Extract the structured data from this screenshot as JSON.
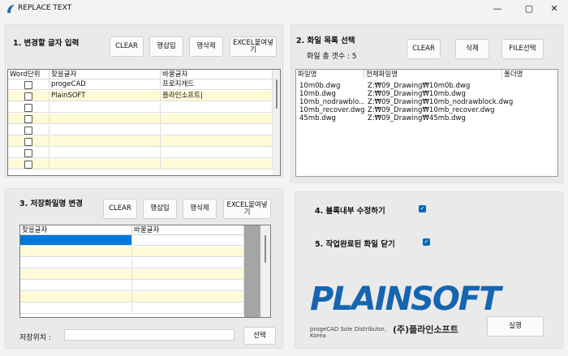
{
  "window": {
    "title": "REPLACE TEXT",
    "min": "—",
    "max": "▢",
    "close": "✕"
  },
  "text_section": {
    "title": "1. 변경할 글자 입력",
    "buttons": [
      "CLEAR",
      "행삽입",
      "행삭제",
      "EXCEL붙여넣기"
    ],
    "columns": [
      "Word단위",
      "찾을글자",
      "바꿀글자"
    ],
    "rows": [
      {
        "find": "progeCAD",
        "replace": "프로지캐드"
      },
      {
        "find": "PlainSOFT",
        "replace": "플라인소프트|"
      },
      {
        "find": "",
        "replace": ""
      },
      {
        "find": "",
        "replace": ""
      },
      {
        "find": "",
        "replace": ""
      },
      {
        "find": "",
        "replace": ""
      },
      {
        "find": "",
        "replace": ""
      },
      {
        "find": "",
        "replace": ""
      }
    ]
  },
  "file_section": {
    "title": "2. 화일 목록 선택",
    "count_label": "화일 총 갯수 : 5",
    "buttons": [
      "CLEAR",
      "삭제",
      "FILE선택"
    ],
    "columns": [
      "파일명",
      "전체파일명",
      "폴더명"
    ],
    "files": [
      {
        "name": "10m0b.dwg",
        "full": "Z:₩09_Drawing₩10m0b.dwg"
      },
      {
        "name": "10mb.dwg",
        "full": "Z:₩09_Drawing₩10mb.dwg"
      },
      {
        "name": "10mb_nodrawblo...",
        "full": "Z:₩09_Drawing₩10mb_nodrawblock.dwg"
      },
      {
        "name": "10mb_recover.dwg",
        "full": "Z:₩09_Drawing₩10mb_recover.dwg"
      },
      {
        "name": "45mb.dwg",
        "full": "Z:₩09_Drawing₩45mb.dwg"
      }
    ]
  },
  "filename_section": {
    "title": "3. 저장화일명 변경",
    "buttons": [
      "CLEAR",
      "행삽입",
      "행삭제",
      "EXCEL붙여넣기"
    ],
    "columns": [
      "찾을글자",
      "바꿀글자"
    ],
    "save_label": "저장위치 :",
    "save_value": "",
    "select_button": "선택"
  },
  "options": {
    "option4": {
      "label": "4. 블록내부 수정하기",
      "checked": true
    },
    "option5": {
      "label": "5. 작업완료된 화일 닫기",
      "checked": true
    }
  },
  "logo": {
    "text": "PLAINSOFT",
    "tagline": "progeCAD Sole Distributor, Korea",
    "brand_kr": "(주)플라인소프트"
  },
  "run_button": "실행",
  "colors": {
    "accent": "#0067c0",
    "row_yellow": "#fffbd8",
    "selected": "#0078d7",
    "logo_blue": "#1565b0"
  }
}
